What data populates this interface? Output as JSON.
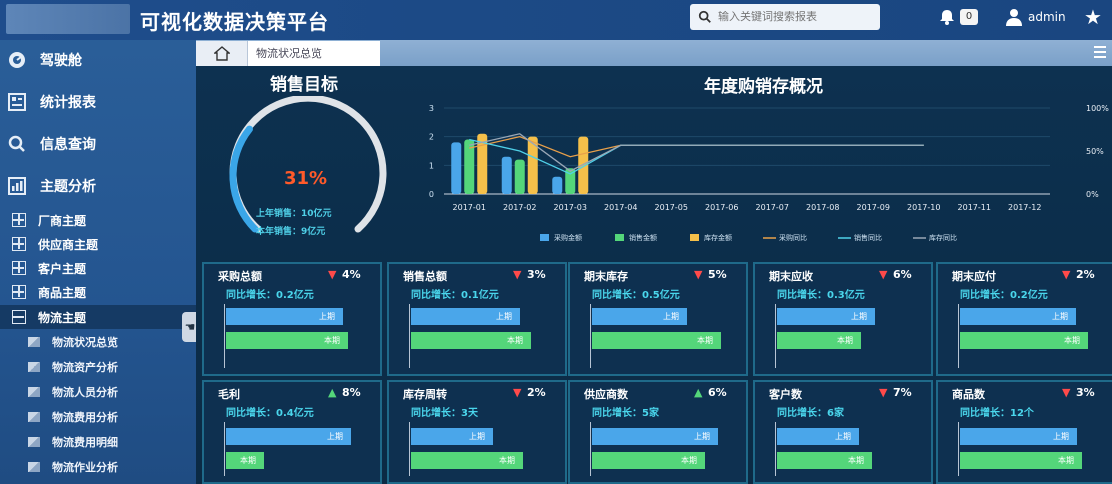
{
  "header": {
    "title": "可视化数据决策平台",
    "search_placeholder": "输入关键词搜索报表",
    "badge": "0",
    "username": "admin"
  },
  "sidebar": {
    "top_items": [
      {
        "label": "驾驶舱",
        "icon": "dashboard-icon"
      },
      {
        "label": "统计报表",
        "icon": "report-icon"
      },
      {
        "label": "信息查询",
        "icon": "search-icon"
      },
      {
        "label": "主题分析",
        "icon": "analysis-icon"
      }
    ],
    "sub_items": [
      "厂商主题",
      "供应商主题",
      "客户主题",
      "商品主题",
      "物流主题"
    ],
    "leaf_items": [
      "物流状况总览",
      "物流资产分析",
      "物流人员分析",
      "物流费用分析",
      "物流费用明细",
      "物流作业分析"
    ]
  },
  "tabs": {
    "page_tab": "物流状况总览"
  },
  "sales_target": {
    "title": "销售目标",
    "percent": "31%",
    "line1": "上年销售：10亿元",
    "line2": "本年销售：9亿元",
    "value": 0.31
  },
  "chart_data": {
    "type": "bar",
    "title": "年度购销存概况",
    "categories": [
      "2017-01",
      "2017-02",
      "2017-03",
      "2017-04",
      "2017-05",
      "2017-06",
      "2017-07",
      "2017-08",
      "2017-09",
      "2017-10",
      "2017-11",
      "2017-12"
    ],
    "series": [
      {
        "name": "采购金额",
        "type": "bar",
        "color": "#4aa6ea",
        "values": [
          1.8,
          1.3,
          0.6,
          null,
          null,
          null,
          null,
          null,
          null,
          null,
          null,
          null
        ]
      },
      {
        "name": "销售金额",
        "type": "bar",
        "color": "#54d67a",
        "values": [
          1.9,
          1.2,
          0.9,
          null,
          null,
          null,
          null,
          null,
          null,
          null,
          null,
          null
        ]
      },
      {
        "name": "库存金额",
        "type": "bar",
        "color": "#f5c04a",
        "values": [
          2.1,
          2.0,
          2.0,
          null,
          null,
          null,
          null,
          null,
          null,
          null,
          null,
          null
        ]
      },
      {
        "name": "采购同比",
        "type": "line",
        "color": "#e8a04a",
        "values": [
          1.6,
          2.0,
          1.3,
          1.7,
          1.7,
          1.7,
          1.7,
          1.7,
          1.7,
          1.7,
          null,
          null
        ]
      },
      {
        "name": "销售同比",
        "type": "line",
        "color": "#4fd0e8",
        "values": [
          1.9,
          1.5,
          0.7,
          1.7,
          1.7,
          1.7,
          1.7,
          1.7,
          1.7,
          1.7,
          null,
          null
        ]
      },
      {
        "name": "库存同比",
        "type": "line",
        "color": "#9aa7b6",
        "values": [
          1.7,
          2.1,
          0.8,
          1.7,
          1.7,
          1.7,
          1.7,
          1.7,
          1.7,
          1.7,
          null,
          null
        ]
      }
    ],
    "y_left_ticks": [
      "0",
      "1",
      "2",
      "3"
    ],
    "y_right_ticks": [
      "0%",
      "50%",
      "100%"
    ],
    "ylim": [
      0,
      3
    ]
  },
  "cards": [
    {
      "title": "采购总额",
      "flag": "▼",
      "flag_color": "#ff4a4a",
      "pct": "4%",
      "growth": "同比增长：0.2亿元",
      "bar1_label": "上期",
      "bar2_label": "本期",
      "bar1": 0.86,
      "bar2": 0.9
    },
    {
      "title": "销售总额",
      "flag": "▼",
      "flag_color": "#ff4a4a",
      "pct": "3%",
      "growth": "同比增长：0.1亿元",
      "bar1_label": "上期",
      "bar2_label": "本期",
      "bar1": 0.8,
      "bar2": 0.88
    },
    {
      "title": "期末库存",
      "flag": "▼",
      "flag_color": "#ff4a4a",
      "pct": "5%",
      "growth": "同比增长：0.5亿元",
      "bar1_label": "上期",
      "bar2_label": "本期",
      "bar1": 0.7,
      "bar2": 0.95
    },
    {
      "title": "期末应收",
      "flag": "▼",
      "flag_color": "#ff4a4a",
      "pct": "6%",
      "growth": "同比增长：0.3亿元",
      "bar1_label": "上期",
      "bar2_label": "本期",
      "bar1": 0.72,
      "bar2": 0.62
    },
    {
      "title": "期末应付",
      "flag": "▼",
      "flag_color": "#ff4a4a",
      "pct": "2%",
      "growth": "同比增长：0.2亿元",
      "bar1_label": "上期",
      "bar2_label": "本期",
      "bar1": 0.85,
      "bar2": 0.94
    },
    {
      "title": "毛利",
      "flag": "▲",
      "flag_color": "#54d67a",
      "pct": "8%",
      "growth": "同比增长：0.4亿元",
      "bar1_label": "上期",
      "bar2_label": "本期",
      "bar1": 0.92,
      "bar2": 0.28
    },
    {
      "title": "库存周转",
      "flag": "▼",
      "flag_color": "#ff4a4a",
      "pct": "2%",
      "growth": "同比增长：3天",
      "bar1_label": "上期",
      "bar2_label": "本期",
      "bar1": 0.6,
      "bar2": 0.82
    },
    {
      "title": "供应商数",
      "flag": "▲",
      "flag_color": "#54d67a",
      "pct": "6%",
      "growth": "同比增长：5家",
      "bar1_label": "上期",
      "bar2_label": "本期",
      "bar1": 0.93,
      "bar2": 0.83
    },
    {
      "title": "客户数",
      "flag": "▼",
      "flag_color": "#ff4a4a",
      "pct": "7%",
      "growth": "同比增长：6家",
      "bar1_label": "上期",
      "bar2_label": "本期",
      "bar1": 0.6,
      "bar2": 0.7
    },
    {
      "title": "商品数",
      "flag": "▼",
      "flag_color": "#ff4a4a",
      "pct": "3%",
      "growth": "同比增长：12个",
      "bar1_label": "上期",
      "bar2_label": "本期",
      "bar1": 0.86,
      "bar2": 0.9
    }
  ]
}
